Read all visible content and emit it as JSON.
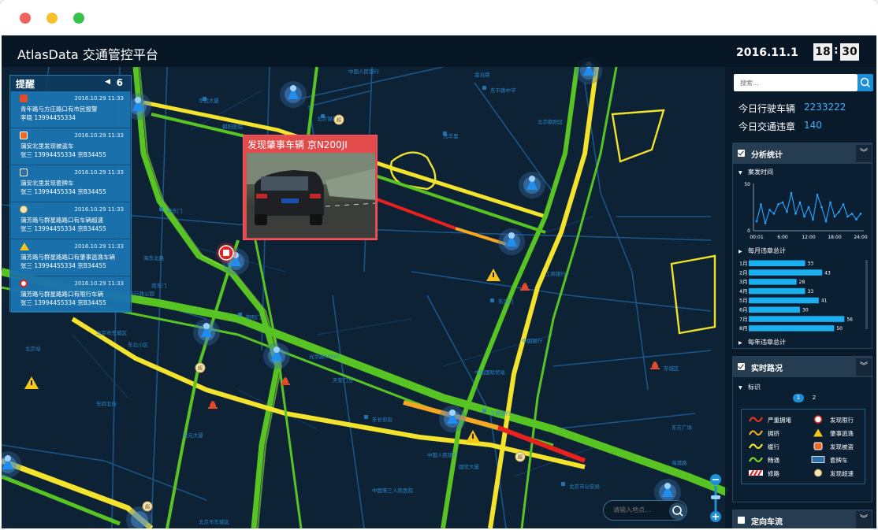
{
  "window": {
    "controls": [
      "close",
      "minimize",
      "maximize"
    ]
  },
  "header": {
    "title": "AtlasData 交通管控平台",
    "date": "2016.11.1",
    "hour": "18",
    "minute": "30",
    "separator": ":"
  },
  "alerts": {
    "title": "提醒",
    "count": "6",
    "items": [
      {
        "icon": "alarm-icon",
        "time": "2016.10.29 11:33",
        "line1": "青年路与方庄路口有市民报警",
        "line2": "李晓  13994455334"
      },
      {
        "icon": "stolen-vehicle-icon",
        "time": "2016.10.29 11:33",
        "line1": "蒲安北里发现被盗车",
        "line2": "张三  13994455334  京B34455"
      },
      {
        "icon": "fake-plate-icon",
        "time": "2016.10.29 11:33",
        "line1": "蒲安北里发现套牌车",
        "line2": "张三  13994455334  京B34455"
      },
      {
        "icon": "speeding-icon",
        "time": "2016.10.29 11:33",
        "line1": "蒲芳路与群星路路口有车辆超速",
        "line2": "张三  13994455334  京B34455"
      },
      {
        "icon": "hit-and-run-icon",
        "time": "2016.10.29 11:33",
        "line1": "蒲芳路与群星路路口有肇事逃逸车辆",
        "line2": "张三  13994455334  京B34455"
      },
      {
        "icon": "restricted-icon",
        "time": "2016.10.29 11:33",
        "line1": "蒲芳路与群星路路口有限行车辆",
        "line2": "张三  13994455334  京B34455"
      }
    ]
  },
  "popup": {
    "title": "发现肇事车辆  京N200JI"
  },
  "map": {
    "labels": [
      "超",
      "超",
      "超",
      "超"
    ],
    "place_search_placeholder": "请输入地点..."
  },
  "sidebar": {
    "search_placeholder": "搜索...",
    "stats": [
      {
        "label": "今日行驶车辆",
        "value": "2233222"
      },
      {
        "label": "今日交通违章",
        "value": "140"
      }
    ],
    "analysis": {
      "title": "分析统计",
      "sections": [
        "案发时间",
        "每月违章总计",
        "每年违章总计"
      ]
    },
    "traffic": {
      "title": "实时路况",
      "section": "标识",
      "pages": [
        "1",
        "2"
      ],
      "legend": [
        {
          "name": "严重拥堵",
          "color": "#e8321e"
        },
        {
          "name": "发现限行",
          "icon": "restricted-icon"
        },
        {
          "name": "拥挤",
          "color": "#f5a623"
        },
        {
          "name": "肇事逃逸",
          "icon": "hit-and-run-icon"
        },
        {
          "name": "缓行",
          "color": "#f3e32c"
        },
        {
          "name": "发现被盗",
          "icon": "stolen-vehicle-icon"
        },
        {
          "name": "畅通",
          "color": "#7ed321"
        },
        {
          "name": "套牌车",
          "icon": "fake-plate-icon"
        },
        {
          "name": "修路",
          "icon": "road-work-icon"
        },
        {
          "name": "发现超速",
          "icon": "speeding-icon"
        }
      ]
    },
    "flow": {
      "title": "定向车流"
    }
  },
  "colors": {
    "accent": "#1d8fd6",
    "map_bg": "#0d2235",
    "road_green": "#6bd22b",
    "road_yellow": "#f5e92d",
    "jam_red": "#e8201e"
  },
  "chart_data": [
    {
      "type": "line",
      "title": "案发时间",
      "x": [
        "00:01",
        "01:00",
        "02:00",
        "03:00",
        "04:00",
        "05:00",
        "06:00",
        "07:00",
        "08:00",
        "09:00",
        "10:00",
        "11:00",
        "12:00",
        "13:00",
        "14:00",
        "15:00",
        "16:00",
        "17:00",
        "18:00",
        "19:00",
        "20:00",
        "21:00",
        "22:00",
        "23:00",
        "24:00"
      ],
      "values": [
        10,
        28,
        8,
        22,
        18,
        28,
        30,
        20,
        40,
        18,
        30,
        15,
        25,
        12,
        38,
        25,
        10,
        30,
        15,
        20,
        28,
        15,
        18,
        12,
        18
      ],
      "xticks": [
        "00:01",
        "6:00",
        "12:00",
        "18:00",
        "24:00"
      ],
      "ylim": [
        0,
        50
      ],
      "yticks": [
        "50",
        "0"
      ]
    },
    {
      "type": "bar",
      "orientation": "horizontal",
      "title": "每月违章总计",
      "categories": [
        "1月",
        "2月",
        "3月",
        "4月",
        "5月",
        "6月",
        "7月",
        "8月"
      ],
      "values": [
        33,
        43,
        28,
        33,
        41,
        30,
        56,
        50
      ],
      "xlim": [
        0,
        60
      ]
    }
  ]
}
